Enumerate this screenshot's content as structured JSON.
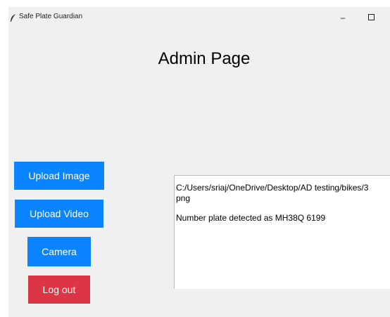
{
  "window": {
    "title": "Safe Plate Guardian",
    "minimize_glyph": "–"
  },
  "page": {
    "title": "Admin Page"
  },
  "buttons": {
    "upload_image": "Upload Image",
    "upload_video": "Upload Video",
    "camera": "Camera",
    "logout": "Log out"
  },
  "output": {
    "lines": [
      "C:/Users/sriaj/OneDrive/Desktop/AD testing/bikes/3",
      "png",
      "Number plate detected as MH38Q 6199"
    ]
  },
  "colors": {
    "button_blue": "#0a84ff",
    "button_red": "#dc3545",
    "window_bg": "#f0f0f0"
  },
  "icons": {
    "app": "feather-icon",
    "minimize": "minimize-icon",
    "maximize": "maximize-icon"
  }
}
